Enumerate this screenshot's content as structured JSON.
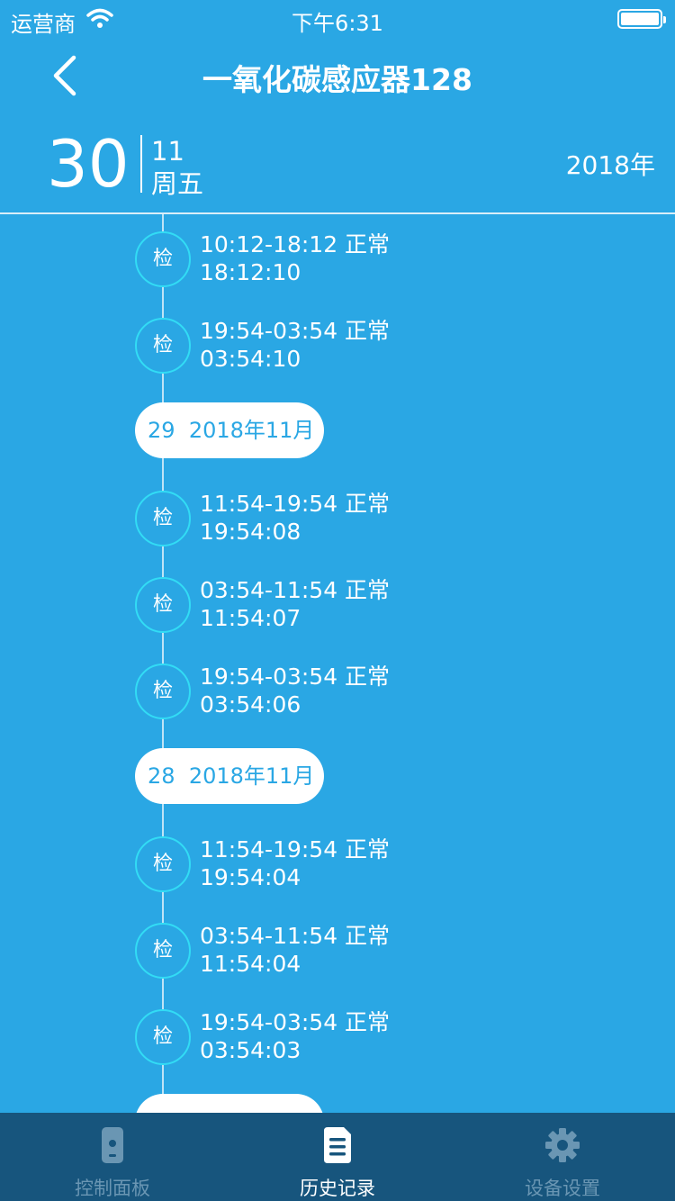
{
  "status_bar": {
    "carrier": "运营商",
    "time": "下午6:31",
    "wifi_icon": "wifi-icon",
    "battery_icon": "battery-icon"
  },
  "nav": {
    "back_icon": "chevron-left-icon",
    "title": "一氧化碳感应器128"
  },
  "date_header": {
    "day": "30",
    "month": "11",
    "weekday": "周五",
    "year": "2018年"
  },
  "timeline": [
    {
      "kind": "entry",
      "badge": "检",
      "line1": "10:12-18:12 正常",
      "line2": "18:12:10"
    },
    {
      "kind": "entry",
      "badge": "检",
      "line1": "19:54-03:54 正常",
      "line2": "03:54:10"
    },
    {
      "kind": "date",
      "day": "29",
      "month": "2018年11月"
    },
    {
      "kind": "entry",
      "badge": "检",
      "line1": "11:54-19:54 正常",
      "line2": "19:54:08"
    },
    {
      "kind": "entry",
      "badge": "检",
      "line1": "03:54-11:54 正常",
      "line2": "11:54:07"
    },
    {
      "kind": "entry",
      "badge": "检",
      "line1": "19:54-03:54 正常",
      "line2": "03:54:06"
    },
    {
      "kind": "date",
      "day": "28",
      "month": "2018年11月"
    },
    {
      "kind": "entry",
      "badge": "检",
      "line1": "11:54-19:54 正常",
      "line2": "19:54:04"
    },
    {
      "kind": "entry",
      "badge": "检",
      "line1": "03:54-11:54 正常",
      "line2": "11:54:04"
    },
    {
      "kind": "entry",
      "badge": "检",
      "line1": "19:54-03:54 正常",
      "line2": "03:54:03"
    },
    {
      "kind": "date",
      "day": "",
      "month": ""
    }
  ],
  "tab_bar": {
    "tabs": [
      {
        "label": "控制面板",
        "icon": "remote-control-icon",
        "active": false
      },
      {
        "label": "历史记录",
        "icon": "document-list-icon",
        "active": true
      },
      {
        "label": "设备设置",
        "icon": "gear-icon",
        "active": false
      }
    ]
  },
  "colors": {
    "background": "#2aa7e4",
    "tab_bar": "#17557d",
    "badge_border": "#32dcf5",
    "inactive_tab": "#6a96b3"
  }
}
